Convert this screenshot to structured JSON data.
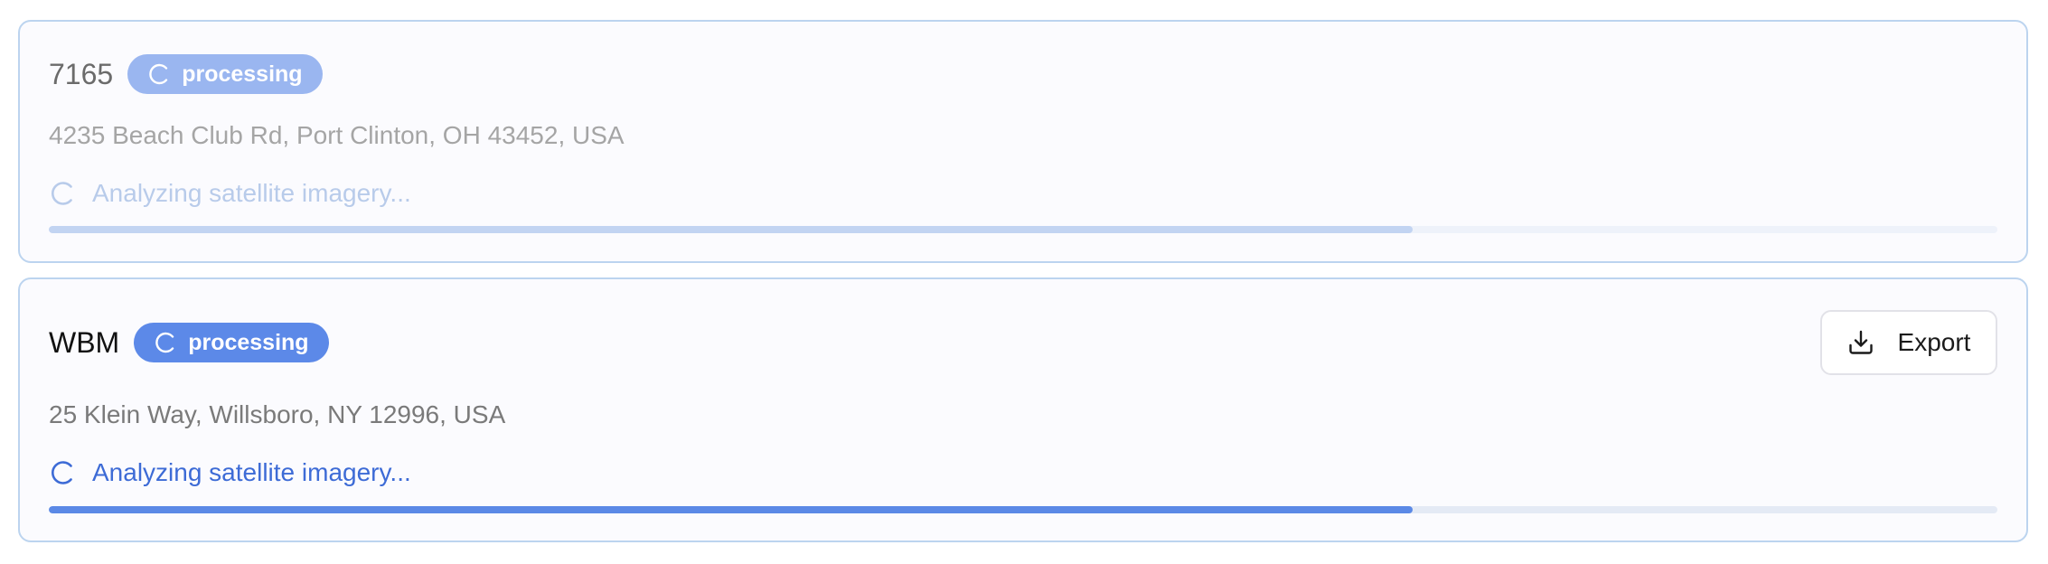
{
  "jobs": [
    {
      "title": "7165",
      "status_badge": "processing",
      "address": "4235 Beach Club Rd, Port Clinton, OH 43452, USA",
      "status_text": "Analyzing satellite imagery...",
      "progress": 0.7,
      "status_icon": "spinner-icon"
    },
    {
      "title": "WBM",
      "status_badge": "processing",
      "address": "25 Klein Way, Willsboro, NY 12996, USA",
      "status_text": "Analyzing satellite imagery...",
      "progress": 0.7,
      "status_icon": "spinner-icon",
      "export_label": "Export",
      "export_icon": "download-icon"
    }
  ],
  "colors": {
    "accent": "#5c89e8",
    "accent_faded": "#9ab6f0",
    "status_text": "#3d6bd6",
    "card_border": "#bcd4ef"
  }
}
